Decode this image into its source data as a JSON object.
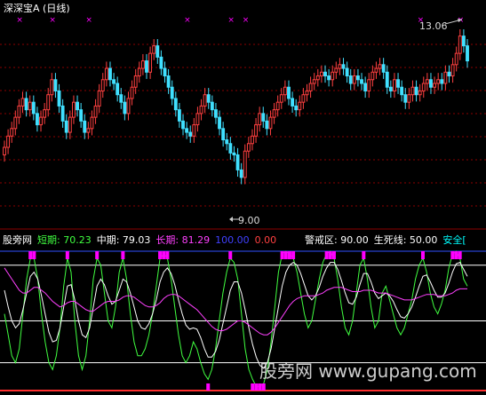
{
  "chart_data": [
    {
      "type": "candlestick",
      "title": "深深宝A (日线)",
      "annotations": {
        "high_label": "13.06",
        "low_label": "9.00"
      },
      "ylim": [
        8.4,
        13.5
      ],
      "x_count": 128,
      "top_x_markers": [
        4,
        13,
        23,
        50,
        62,
        66,
        114,
        125
      ],
      "colors": {
        "up": "#ff4040",
        "down": "#40e0ff",
        "marker": "#ff00ff",
        "grid": "#8b0000",
        "title": "#ffffff",
        "arrow": "#cccccc"
      },
      "close": [
        10.1,
        10.4,
        10.6,
        10.9,
        11.2,
        11.4,
        11.1,
        11.3,
        11.0,
        10.7,
        10.9,
        11.1,
        11.5,
        11.9,
        11.6,
        11.2,
        10.8,
        10.5,
        10.9,
        11.3,
        11.1,
        10.8,
        10.5,
        10.6,
        10.9,
        11.2,
        11.6,
        11.9,
        12.2,
        11.9,
        11.8,
        11.5,
        11.3,
        11.0,
        11.4,
        11.7,
        12.0,
        12.2,
        12.4,
        12.1,
        12.6,
        12.8,
        12.5,
        12.2,
        12.0,
        11.7,
        11.4,
        11.1,
        10.8,
        10.6,
        10.5,
        10.4,
        10.7,
        11.0,
        11.2,
        11.5,
        11.3,
        11.1,
        10.9,
        10.6,
        10.3,
        10.2,
        9.95,
        9.9,
        9.5,
        9.3,
        10.0,
        10.2,
        10.4,
        10.7,
        11.0,
        10.8,
        10.6,
        10.9,
        11.1,
        11.3,
        11.5,
        11.7,
        11.4,
        11.2,
        11.1,
        11.3,
        11.5,
        11.6,
        11.8,
        11.9,
        12.0,
        12.1,
        12.0,
        11.9,
        12.1,
        12.2,
        12.3,
        12.2,
        12.0,
        11.8,
        12.0,
        11.9,
        11.8,
        11.6,
        11.9,
        12.1,
        12.2,
        12.3,
        12.1,
        11.7,
        11.6,
        11.9,
        11.7,
        11.5,
        11.3,
        11.5,
        11.7,
        11.5,
        11.6,
        11.8,
        11.9,
        11.7,
        11.8,
        11.9,
        11.8,
        12.1,
        12.0,
        12.3,
        12.6,
        13.06,
        12.8,
        12.4
      ]
    },
    {
      "type": "line",
      "legend": [
        {
          "label": "股旁网",
          "value": "",
          "color": "#ffffff"
        },
        {
          "label": "短期:",
          "value": "70.23",
          "color": "#40ff40"
        },
        {
          "label": "中期:",
          "value": "79.03",
          "color": "#ffffff"
        },
        {
          "label": "长期:",
          "value": "81.29",
          "color": "#ff40ff"
        },
        {
          "label": "",
          "value": "100.00",
          "color": "#4040ff"
        },
        {
          "label": "",
          "value": "0.00",
          "color": "#ff4040"
        },
        {
          "label": "警戒区:",
          "value": "90.00",
          "color": "#ffffff"
        },
        {
          "label": "生死线:",
          "value": "50.00",
          "color": "#ffffff"
        },
        {
          "label": "安全[",
          "value": "",
          "color": "#00ffff"
        }
      ],
      "ylim": [
        0,
        100
      ],
      "hlines": [
        {
          "value": 100,
          "color": "#3050ff"
        },
        {
          "value": 90,
          "color": "#ffffff"
        },
        {
          "value": 50,
          "color": "#ffffff"
        },
        {
          "value": 20,
          "color": "#ffffff"
        },
        {
          "value": 0,
          "color": "#ff3030"
        }
      ],
      "series": [
        {
          "color": "#40ff40",
          "values": [
            55,
            40,
            25,
            20,
            30,
            55,
            80,
            95,
            95,
            80,
            55,
            35,
            20,
            15,
            25,
            45,
            75,
            95,
            85,
            50,
            25,
            15,
            25,
            50,
            80,
            95,
            90,
            70,
            50,
            45,
            60,
            85,
            95,
            80,
            55,
            35,
            25,
            25,
            30,
            40,
            55,
            75,
            95,
            98,
            95,
            80,
            60,
            40,
            25,
            20,
            25,
            35,
            30,
            20,
            12,
            8,
            15,
            30,
            50,
            70,
            85,
            95,
            92,
            80,
            55,
            30,
            15,
            8,
            3,
            3,
            5,
            15,
            35,
            60,
            85,
            98,
            100,
            98,
            95,
            85,
            70,
            55,
            45,
            50,
            65,
            80,
            92,
            98,
            100,
            95,
            80,
            60,
            45,
            40,
            50,
            70,
            90,
            95,
            80,
            60,
            45,
            50,
            70,
            75,
            65,
            55,
            45,
            40,
            45,
            55,
            65,
            80,
            90,
            95,
            85,
            70,
            60,
            55,
            62,
            72,
            88,
            98,
            100,
            95,
            80,
            75
          ]
        },
        {
          "color": "#ffffff",
          "values": [
            72,
            60,
            50,
            45,
            48,
            58,
            70,
            82,
            85,
            80,
            68,
            55,
            42,
            35,
            36,
            45,
            60,
            75,
            76,
            65,
            50,
            40,
            38,
            45,
            60,
            75,
            80,
            76,
            68,
            62,
            64,
            72,
            80,
            78,
            70,
            60,
            50,
            45,
            44,
            48,
            55,
            65,
            78,
            85,
            88,
            84,
            76,
            65,
            55,
            47,
            44,
            45,
            44,
            38,
            30,
            24,
            24,
            28,
            36,
            48,
            60,
            72,
            78,
            78,
            70,
            58,
            45,
            33,
            24,
            18,
            16,
            20,
            30,
            45,
            60,
            75,
            85,
            90,
            92,
            90,
            84,
            76,
            68,
            65,
            68,
            74,
            82,
            88,
            92,
            92,
            87,
            79,
            70,
            63,
            62,
            67,
            76,
            84,
            84,
            78,
            70,
            66,
            68,
            70,
            68,
            64,
            58,
            53,
            52,
            55,
            60,
            67,
            75,
            82,
            83,
            78,
            72,
            67,
            67,
            70,
            77,
            85,
            91,
            92,
            87,
            82
          ]
        },
        {
          "color": "#ff40ff",
          "values": [
            88,
            84,
            80,
            76,
            72,
            70,
            70,
            72,
            74,
            74,
            72,
            70,
            67,
            64,
            62,
            60,
            61,
            63,
            64,
            64,
            62,
            60,
            58,
            57,
            57,
            59,
            61,
            63,
            64,
            64,
            64,
            65,
            67,
            68,
            68,
            67,
            65,
            63,
            61,
            60,
            60,
            61,
            63,
            66,
            68,
            69,
            69,
            68,
            66,
            64,
            62,
            60,
            58,
            55,
            52,
            49,
            46,
            44,
            43,
            43,
            44,
            46,
            48,
            50,
            50,
            49,
            47,
            45,
            43,
            41,
            40,
            40,
            42,
            45,
            49,
            53,
            57,
            61,
            64,
            66,
            67,
            68,
            68,
            68,
            68,
            69,
            70,
            72,
            73,
            74,
            74,
            74,
            73,
            72,
            71,
            71,
            71,
            72,
            72,
            72,
            71,
            70,
            70,
            70,
            69,
            68,
            67,
            66,
            65,
            65,
            65,
            66,
            67,
            68,
            69,
            69,
            69,
            68,
            68,
            68,
            69,
            70,
            72,
            73,
            73,
            73
          ]
        }
      ]
    }
  ],
  "watermark": "股旁网 www.gupang.com"
}
